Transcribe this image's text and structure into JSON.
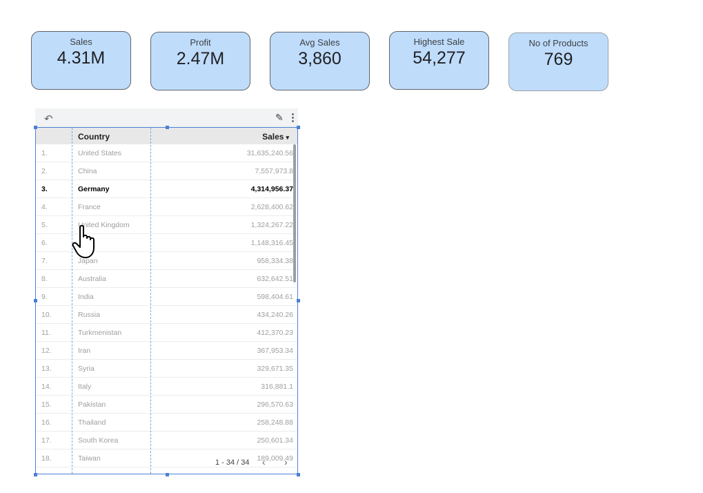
{
  "kpis": [
    {
      "label": "Sales",
      "value": "4.31M"
    },
    {
      "label": "Profit",
      "value": "2.47M"
    },
    {
      "label": "Avg Sales",
      "value": "3,860"
    },
    {
      "label": "Highest Sale",
      "value": "54,277"
    },
    {
      "label": "No of Products",
      "value": "769"
    }
  ],
  "table": {
    "columns": {
      "country": "Country",
      "sales": "Sales"
    },
    "rows": [
      {
        "idx": "1.",
        "country": "United States",
        "sales": "31,635,240.56"
      },
      {
        "idx": "2.",
        "country": "China",
        "sales": "7,557,973.8"
      },
      {
        "idx": "3.",
        "country": "Germany",
        "sales": "4,314,956.37"
      },
      {
        "idx": "4.",
        "country": "France",
        "sales": "2,628,400.62"
      },
      {
        "idx": "5.",
        "country": "United Kingdom",
        "sales": "1,324,267.22"
      },
      {
        "idx": "6.",
        "country": "",
        "sales": "1,148,316.45"
      },
      {
        "idx": "7.",
        "country": "Japan",
        "sales": "958,334.38"
      },
      {
        "idx": "8.",
        "country": "Australia",
        "sales": "632,642.51"
      },
      {
        "idx": "9.",
        "country": "India",
        "sales": "598,404.61"
      },
      {
        "idx": "10.",
        "country": "Russia",
        "sales": "434,240.26"
      },
      {
        "idx": "11.",
        "country": "Turkmenistan",
        "sales": "412,370.23"
      },
      {
        "idx": "12.",
        "country": "Iran",
        "sales": "367,953.34"
      },
      {
        "idx": "13.",
        "country": "Syria",
        "sales": "329,671.35"
      },
      {
        "idx": "14.",
        "country": "Italy",
        "sales": "316,881.1"
      },
      {
        "idx": "15.",
        "country": "Pakistan",
        "sales": "296,570.63"
      },
      {
        "idx": "16.",
        "country": "Thailand",
        "sales": "258,248.88"
      },
      {
        "idx": "17.",
        "country": "South Korea",
        "sales": "250,601.34"
      },
      {
        "idx": "18.",
        "country": "Taiwan",
        "sales": "189,009.49"
      }
    ],
    "highlighted_row": 2,
    "pagination": "1 - 34 / 34"
  },
  "icons": {
    "undo": "undo-icon",
    "edit": "pencil-icon",
    "more": "more-vert-icon",
    "sort": "sort-desc-icon",
    "cursor": "hand-pointer-icon"
  },
  "colors": {
    "kpi_background": "#bfdcfb",
    "selection": "#4a7fd6"
  }
}
